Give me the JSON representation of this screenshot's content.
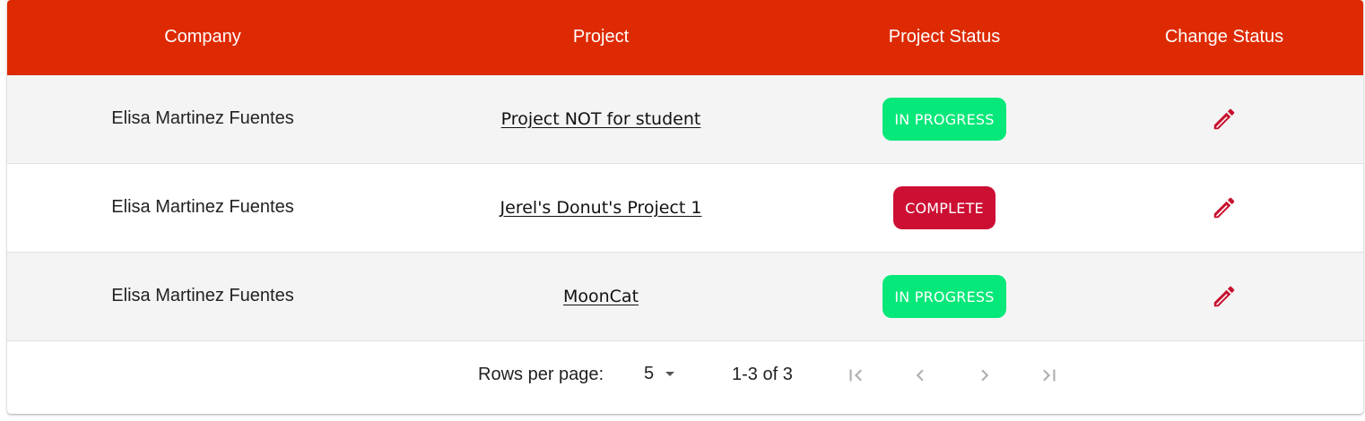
{
  "table": {
    "headers": {
      "company": "Company",
      "project": "Project",
      "project_status": "Project Status",
      "change_status": "Change Status"
    },
    "rows": [
      {
        "company": "Elisa Martinez Fuentes",
        "project": "Project NOT for student",
        "status": "IN PROGRESS",
        "status_color": "#06e879"
      },
      {
        "company": "Elisa Martinez Fuentes",
        "project": "Jerel's Donut's Project 1",
        "status": "COMPLETE",
        "status_color": "#cc0f33"
      },
      {
        "company": "Elisa Martinez Fuentes",
        "project": "MoonCat",
        "status": "IN PROGRESS",
        "status_color": "#06e879"
      }
    ]
  },
  "pagination": {
    "rows_per_page_label": "Rows per page:",
    "rows_per_page_value": "5",
    "range_text": "1-3 of 3",
    "icons": [
      "first-page-icon",
      "previous-page-icon",
      "next-page-icon",
      "last-page-icon"
    ]
  },
  "colors": {
    "header_bg": "#de2a02",
    "in_progress": "#06e879",
    "complete": "#cc0f33",
    "edit_icon": "#c8102e"
  },
  "icons": {
    "edit": "pencil-icon",
    "dropdown": "caret-down-icon"
  }
}
